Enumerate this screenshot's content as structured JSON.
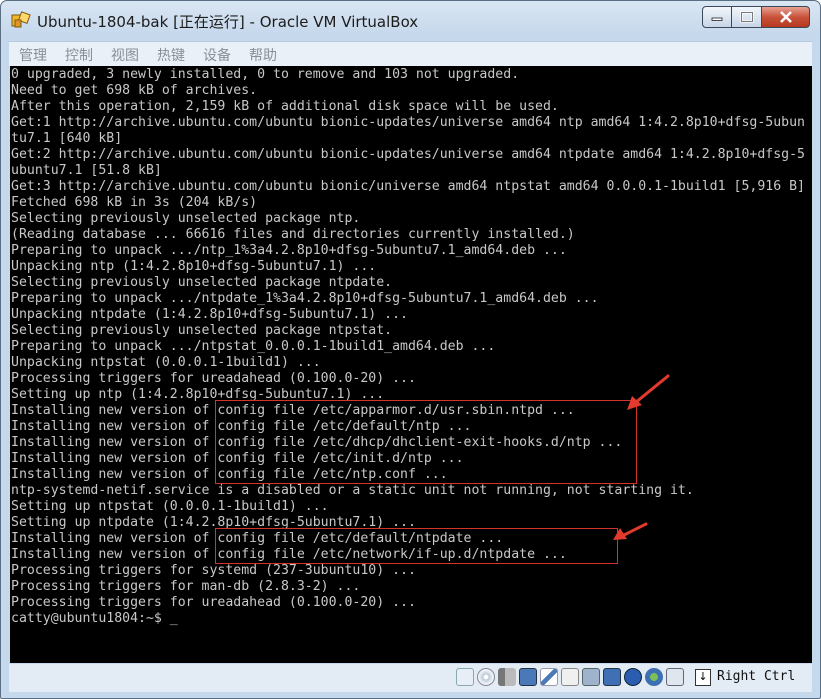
{
  "window": {
    "title": "Ubuntu-1804-bak [正在运行] - Oracle VM VirtualBox"
  },
  "menubar": {
    "items": [
      "管理",
      "控制",
      "视图",
      "热键",
      "设备",
      "帮助"
    ]
  },
  "terminal": {
    "lines": [
      "0 upgraded, 3 newly installed, 0 to remove and 103 not upgraded.",
      "Need to get 698 kB of archives.",
      "After this operation, 2,159 kB of additional disk space will be used.",
      "Get:1 http://archive.ubuntu.com/ubuntu bionic-updates/universe amd64 ntp amd64 1:4.2.8p10+dfsg-5ubun",
      "tu7.1 [640 kB]",
      "Get:2 http://archive.ubuntu.com/ubuntu bionic-updates/universe amd64 ntpdate amd64 1:4.2.8p10+dfsg-5",
      "ubuntu7.1 [51.8 kB]",
      "Get:3 http://archive.ubuntu.com/ubuntu bionic/universe amd64 ntpstat amd64 0.0.0.1-1build1 [5,916 B]",
      "Fetched 698 kB in 3s (204 kB/s)",
      "Selecting previously unselected package ntp.",
      "(Reading database ... 66616 files and directories currently installed.)",
      "Preparing to unpack .../ntp_1%3a4.2.8p10+dfsg-5ubuntu7.1_amd64.deb ...",
      "Unpacking ntp (1:4.2.8p10+dfsg-5ubuntu7.1) ...",
      "Selecting previously unselected package ntpdate.",
      "Preparing to unpack .../ntpdate_1%3a4.2.8p10+dfsg-5ubuntu7.1_amd64.deb ...",
      "Unpacking ntpdate (1:4.2.8p10+dfsg-5ubuntu7.1) ...",
      "Selecting previously unselected package ntpstat.",
      "Preparing to unpack .../ntpstat_0.0.0.1-1build1_amd64.deb ...",
      "Unpacking ntpstat (0.0.0.1-1build1) ...",
      "Processing triggers for ureadahead (0.100.0-20) ...",
      "Setting up ntp (1:4.2.8p10+dfsg-5ubuntu7.1) ...",
      "Installing new version of config file /etc/apparmor.d/usr.sbin.ntpd ...",
      "Installing new version of config file /etc/default/ntp ...",
      "Installing new version of config file /etc/dhcp/dhclient-exit-hooks.d/ntp ...",
      "Installing new version of config file /etc/init.d/ntp ...",
      "Installing new version of config file /etc/ntp.conf ...",
      "ntp-systemd-netif.service is a disabled or a static unit not running, not starting it.",
      "Setting up ntpstat (0.0.0.1-1build1) ...",
      "Setting up ntpdate (1:4.2.8p10+dfsg-5ubuntu7.1) ...",
      "Installing new version of config file /etc/default/ntpdate ...",
      "Installing new version of config file /etc/network/if-up.d/ntpdate ...",
      "Processing triggers for systemd (237-3ubuntu10) ...",
      "Processing triggers for man-db (2.8.3-2) ...",
      "Processing triggers for ureadahead (0.100.0-20) ...",
      "catty@ubuntu1804:~$ _"
    ]
  },
  "statusbar": {
    "icons": [
      "hard-disk-icon",
      "optical-drive-icon",
      "audio-icon",
      "network-icon",
      "usb-icon",
      "shared-folders-icon",
      "display-icon",
      "video-capture-icon",
      "guest-additions-icon",
      "cpu-icon",
      "mouse-integration-icon"
    ],
    "host_key": "Right Ctrl"
  },
  "colors": {
    "terminal_bg": "#000000",
    "terminal_fg": "#c8c8c8",
    "highlight": "#d2342c",
    "close_button": "#c8533a"
  }
}
